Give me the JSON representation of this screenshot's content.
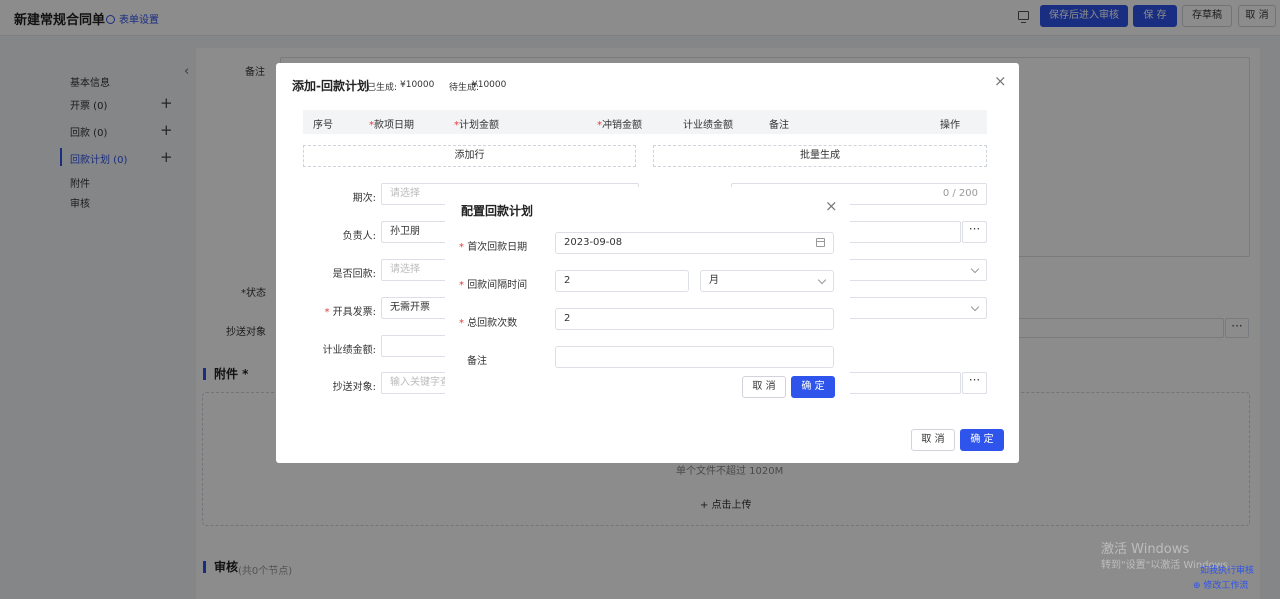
{
  "header": {
    "title": "新建常规合同单",
    "form_settings": "表单设置",
    "save_and_review": "保存后进入审核",
    "save": "保 存",
    "draft": "存草稿",
    "cancel": "取 消"
  },
  "sidebar": {
    "items": [
      {
        "label": "基本信息"
      },
      {
        "label": "开票  (0)"
      },
      {
        "label": "回款  (0)"
      },
      {
        "label": "回款计划  (0)"
      },
      {
        "label": "附件"
      },
      {
        "label": "审核"
      }
    ]
  },
  "background": {
    "remarks_label": "备注",
    "status_label": "*状态",
    "cc_label": "抄送对象",
    "attachment_title": "附件 *",
    "upload_hint": "单个文件不超过 1020M",
    "upload_button": "+ 点击上传",
    "review_title": "审核",
    "review_sub": "(共0个节点)",
    "review_link_1": "如我执行审核",
    "review_link_2": "修改工作流"
  },
  "dialog_main": {
    "title": "添加-回款计划",
    "generated_label": "已生成:",
    "generated_value": "¥10000",
    "pending_label": "待生成:",
    "pending_value": "¥10000",
    "columns": [
      "序号",
      "款项日期",
      "计划金额",
      "冲销金额",
      "计业绩金额",
      "备注",
      "操作"
    ],
    "add_row": "添加行",
    "batch_generate": "批量生成",
    "fields": {
      "period_label": "期次:",
      "period_placeholder": "请选择",
      "remark_counter": "0 / 200",
      "owner_label": "负责人:",
      "owner_value": "孙卫朋",
      "is_collected_label": "是否回款:",
      "is_collected_placeholder": "请选择",
      "invoice_label": "开具发票:",
      "invoice_value": "无需开票",
      "performance_label": "计业绩金额:",
      "cc_label": "抄送对象:",
      "cc_placeholder": "输入关键字查"
    },
    "cancel": "取 消",
    "confirm": "确 定"
  },
  "dialog_config": {
    "title": "配置回款计划",
    "first_date_label": "首次回款日期",
    "first_date_value": "2023-09-08",
    "interval_label": "回款间隔时间",
    "interval_value": "2",
    "interval_unit": "月",
    "total_label": "总回款次数",
    "total_value": "2",
    "remark_label": "备注",
    "remark_value": "",
    "cancel": "取 消",
    "confirm": "确 定"
  },
  "watermark": {
    "line1": "激活 Windows",
    "line2": "转到\"设置\"以激活 Windows。"
  },
  "colors": {
    "primary": "#2f54eb",
    "required": "#e4393c",
    "overlay": "rgba(0,0,0,0.45)"
  }
}
